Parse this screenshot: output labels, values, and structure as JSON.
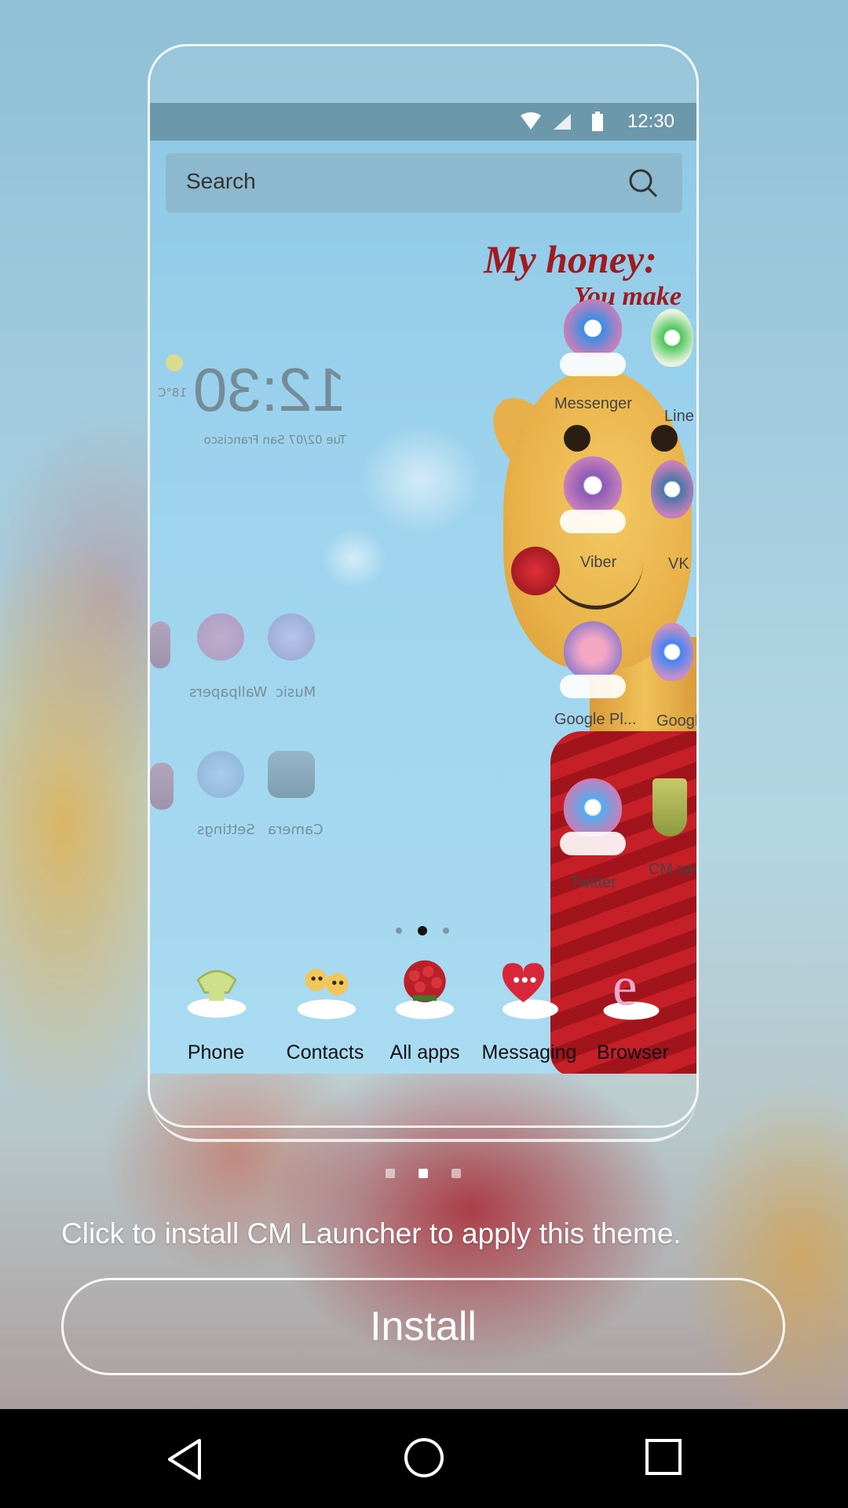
{
  "preview": {
    "status_time": "12:30",
    "search_placeholder": "Search",
    "wallpaper_title": "My honey:",
    "wallpaper_subtitle": "You make",
    "clock_time": "12:30",
    "clock_date": "Tue 02/07 San Francisco",
    "weather_temp": "18°C",
    "left_icons": [
      {
        "label": "Wallpapers",
        "icon": "flower-icon"
      },
      {
        "label": "Music",
        "icon": "headphones-icon"
      },
      {
        "label": "Settings",
        "icon": "gear-icon"
      },
      {
        "label": "Camera",
        "icon": "camera-icon"
      }
    ],
    "right_icons": [
      {
        "label": "Messenger",
        "icon": "messenger-icon",
        "color": "#3a8ee6"
      },
      {
        "label": "Line",
        "icon": "line-icon",
        "color": "#4cc55a"
      },
      {
        "label": "Viber",
        "icon": "viber-icon",
        "color": "#8a5bb8"
      },
      {
        "label": "VK",
        "icon": "vk-icon",
        "color": "#4a76a8"
      },
      {
        "label": "Google Pl...",
        "icon": "play-store-icon",
        "color": "#9c7fc9"
      },
      {
        "label": "Google",
        "icon": "google-icon",
        "color": "#c98fc4"
      },
      {
        "label": "Twitter",
        "icon": "twitter-icon",
        "color": "#55acee"
      },
      {
        "label": "CM secu...",
        "icon": "shield-icon",
        "color": "#9aa64a"
      }
    ],
    "dock": [
      {
        "label": "Phone",
        "icon": "phone-icon"
      },
      {
        "label": "Contacts",
        "icon": "contacts-icon"
      },
      {
        "label": "All apps",
        "icon": "all-apps-icon"
      },
      {
        "label": "Messaging",
        "icon": "messaging-icon"
      },
      {
        "label": "Browser",
        "icon": "browser-icon"
      }
    ]
  },
  "instruction": "Click to install CM Launcher to apply this theme.",
  "install_label": "Install",
  "colors": {
    "accent_red": "#9e1b21",
    "sky": "#9fd4ee"
  }
}
